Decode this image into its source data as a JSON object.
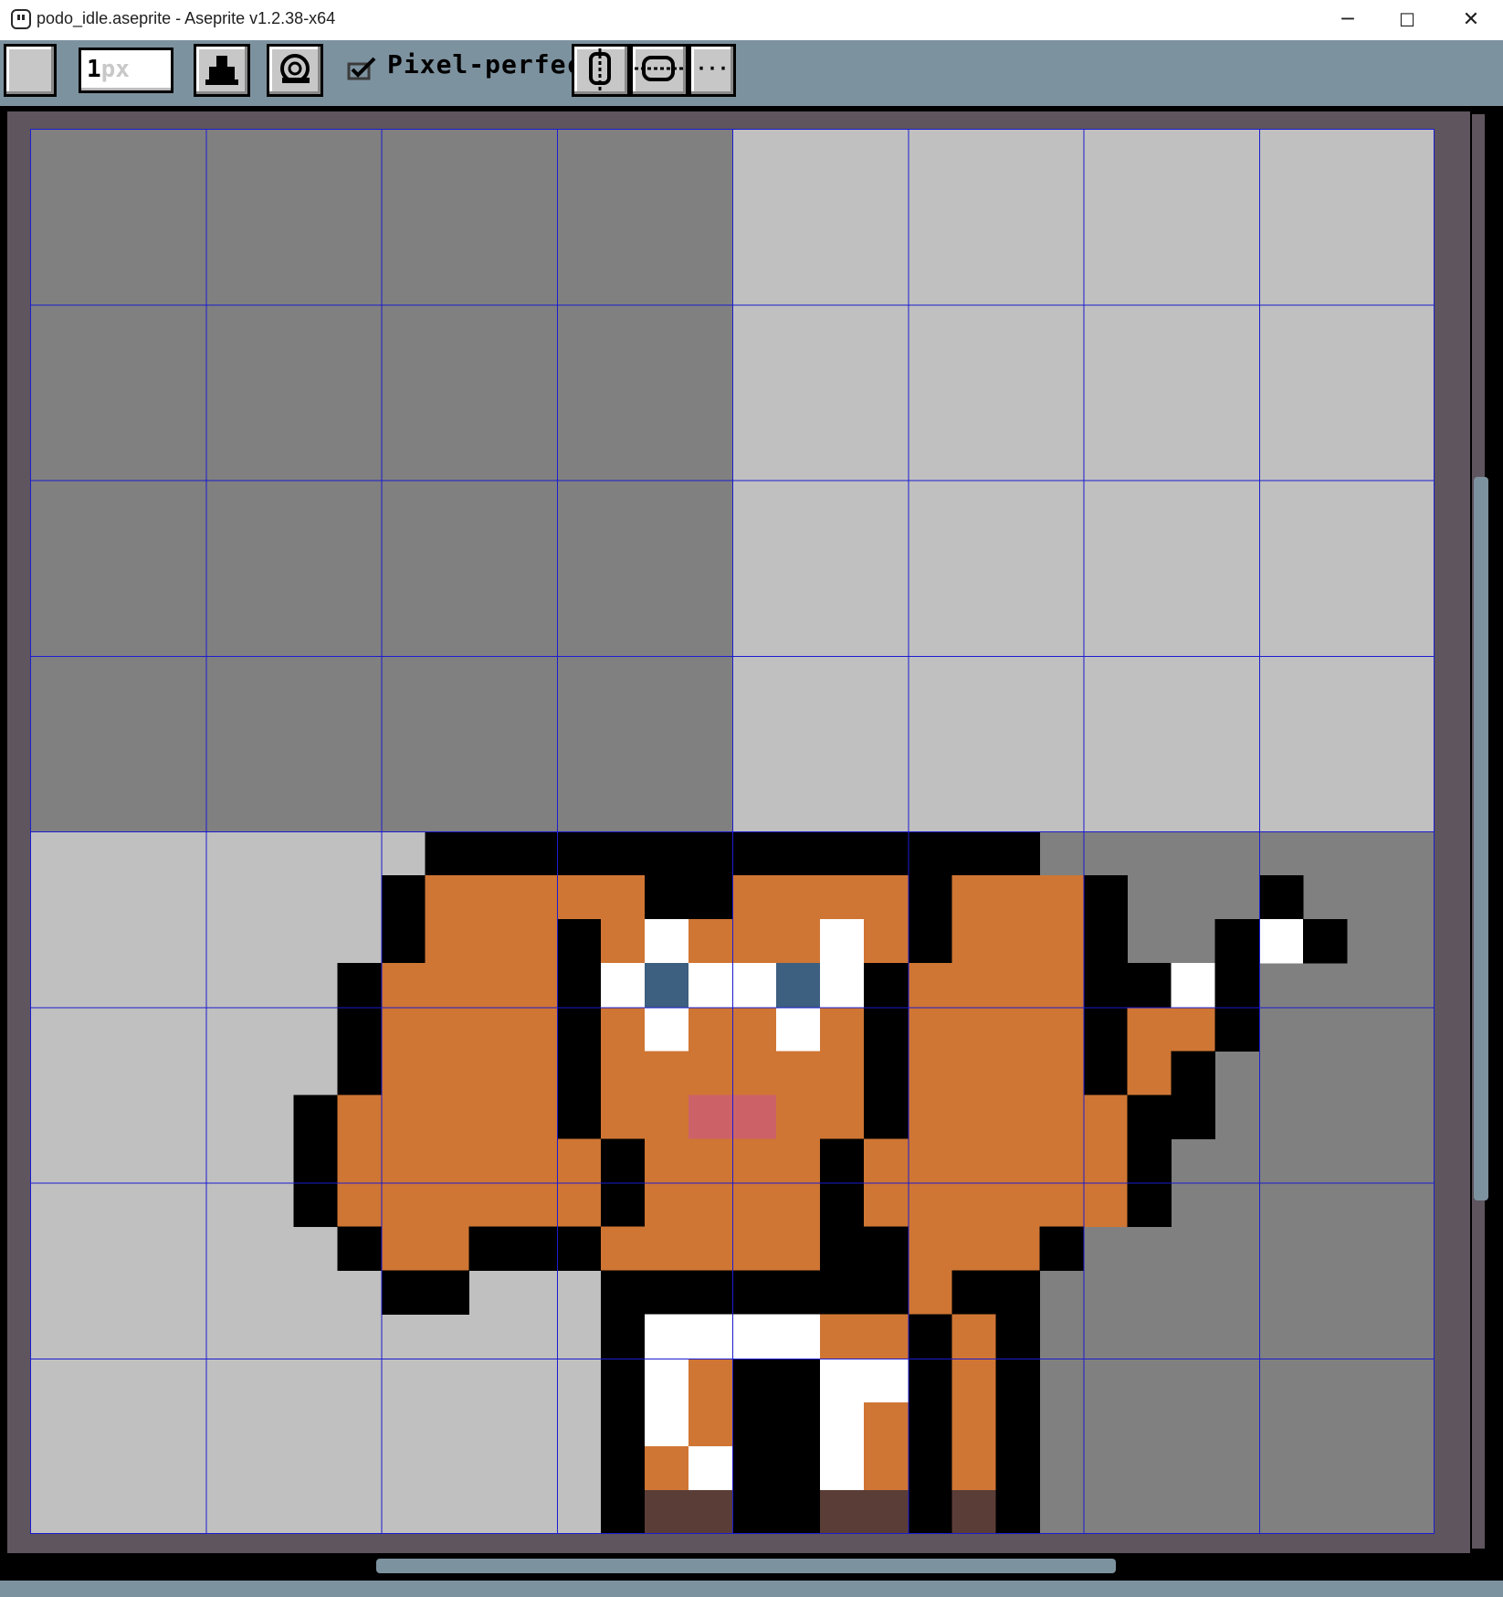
{
  "window": {
    "title": "podo_idle.aseprite - Aseprite v1.2.38-x64",
    "controls": {
      "minimize": "─",
      "maximize": "☐",
      "close": "✕"
    }
  },
  "toolbar": {
    "brush_size_value": "1",
    "brush_size_unit": "px",
    "ink_icon": "ink-bucket-icon",
    "pressure_icon": "pen-pressure-icon",
    "pixel_perfect_checked": true,
    "pixel_perfect_label": "Pixel-perfect",
    "dynamics_icons": [
      "vertical-symmetry-icon",
      "horizontal-symmetry-icon"
    ],
    "more_label": "···"
  },
  "canvas": {
    "grid_size": 32,
    "tile_grid_every": 4,
    "colors": {
      "checker_dark": "#808080",
      "checker_light": "#c0c0c0",
      "outline": "#000000",
      "skin": "#cf7634",
      "white": "#ffffff",
      "eye": "#3d5f80",
      "blush": "#cc6268",
      "shoe": "#5b3d37",
      "grid_line": "#1c1ccf"
    },
    "palette_key": {
      "K": "outline",
      "O": "skin",
      "W": "white",
      "B": "eye",
      "P": "blush",
      "S": "shoe"
    },
    "sprite_rows": [
      "         KKKKKKKKKKKKKK         ",
      "        KOOOOOKKOOOOKOOOK   K    ",
      "        KOOOKOWOOOWOKOOOK  KWK   ",
      "       KOOOOKWBWWBWKOOOOKKWK   ",
      "       KOOOOKOWOOWOKOOOOKOOK   ",
      "       KOOOOKOOOOOOKOOOOKOK    ",
      "      KOOOOOKOOPPOOKOOOOOKK    ",
      "      KOOOOOOKOOOOKOOOOOOK     ",
      "      KOOOOOOKOOOOKOOOOOOK     ",
      "       KOOKKKOOOOOKKOOOK      ",
      "        KK   KKKKKKKOKK       ",
      "             KWWWWOOKOK       ",
      "             KWOKKWWKOK       ",
      "             KWOKKWOKOK       ",
      "             KOWKKWOKOK       ",
      "             KSSKKSSKSK       "
    ]
  }
}
